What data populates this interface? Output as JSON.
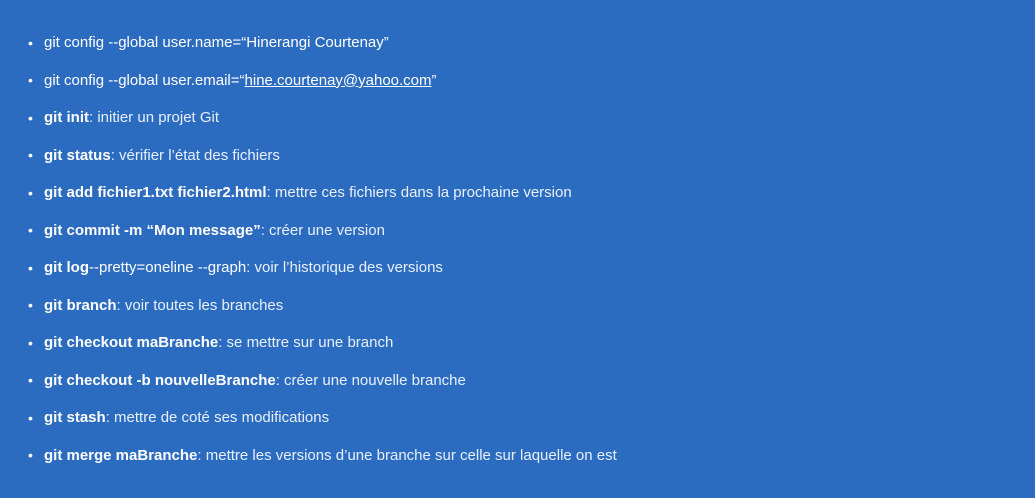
{
  "bullet": "•",
  "items": [
    {
      "plain": "git config --global user.name=“Hinerangi Courtenay”"
    },
    {
      "plain_before": "git config  --global user.email=“",
      "email": "hine.courtenay@yahoo.com",
      "plain_after": "”"
    },
    {
      "cmd": "git init",
      "desc": " : initier un projet Git"
    },
    {
      "cmd": "git status",
      "desc": " : vérifier l’état des fichiers"
    },
    {
      "cmd": "git add fichier1.txt fichier2.html",
      "desc": " : mettre ces fichiers dans la prochaine version"
    },
    {
      "cmd": "git commit -m “Mon message”",
      "desc": " : créer une version"
    },
    {
      "cmd": "git log",
      "plain": " --pretty=oneline --graph",
      "desc": " : voir l’historique des versions"
    },
    {
      "cmd": "git branch",
      "desc": " : voir toutes les branches"
    },
    {
      "cmd": "git checkout maBranche",
      "desc": " : se mettre sur une branch"
    },
    {
      "cmd": "git checkout -b nouvelleBranche",
      "desc": " : créer une nouvelle branche"
    },
    {
      "cmd": "git stash",
      "desc": " : mettre de coté ses modifications"
    },
    {
      "cmd": "git merge maBranche",
      "desc": " : mettre les versions d’une branche sur celle sur laquelle on est"
    }
  ]
}
